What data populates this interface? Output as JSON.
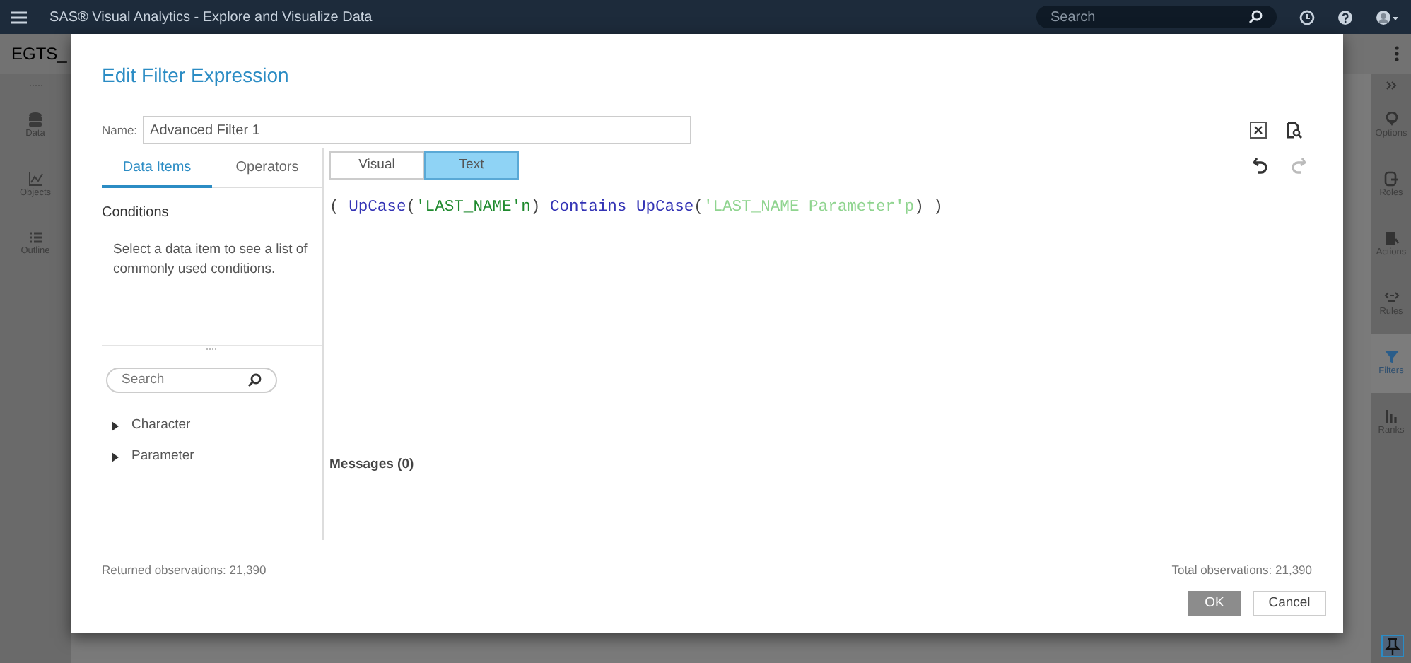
{
  "app": {
    "title": "SAS® Visual Analytics - Explore and Visualize Data",
    "search_placeholder": "Search",
    "report_title": "EGTS_",
    "left_rail": [
      {
        "label": "Data"
      },
      {
        "label": "Objects"
      },
      {
        "label": "Outline"
      }
    ],
    "right_rail": [
      {
        "label": "Options",
        "selected": false
      },
      {
        "label": "Roles",
        "selected": false
      },
      {
        "label": "Actions",
        "selected": false
      },
      {
        "label": "Rules",
        "selected": false
      },
      {
        "label": "Filters",
        "selected": true
      },
      {
        "label": "Ranks",
        "selected": false
      }
    ]
  },
  "dialog": {
    "title": "Edit Filter Expression",
    "name_label": "Name:",
    "name_value": "Advanced Filter 1",
    "history_buttons": [
      {
        "disabled": false
      },
      {
        "disabled": true
      }
    ],
    "tabs": [
      {
        "label": "Data Items",
        "selected": true
      },
      {
        "label": "Operators",
        "selected": false
      }
    ],
    "section": "Conditions",
    "hint": "Select a data item to see a list of commonly used conditions.",
    "search_placeholder": "Search",
    "tree": [
      {
        "label": "Character",
        "expanded": false
      },
      {
        "label": "Parameter",
        "expanded": false
      }
    ],
    "modes": [
      {
        "label": "Visual",
        "selected": false
      },
      {
        "label": "Text",
        "selected": true
      }
    ],
    "expression": [
      {
        "text": "( ",
        "kind": "punct"
      },
      {
        "text": "UpCase",
        "kind": "function"
      },
      {
        "text": "(",
        "kind": "punct"
      },
      {
        "text": "'LAST_NAME'n",
        "kind": "column"
      },
      {
        "text": ")",
        "kind": "punct"
      },
      {
        "text": " Contains ",
        "kind": "operator"
      },
      {
        "text": "UpCase",
        "kind": "function"
      },
      {
        "text": "(",
        "kind": "punct"
      },
      {
        "text": "'LAST_NAME Parameter'p",
        "kind": "parameter"
      },
      {
        "text": ") )",
        "kind": "punct"
      }
    ],
    "messages": "Messages (0)",
    "returned": "Returned observations: 21,390",
    "total": "Total observations: 21,390",
    "buttons": [
      {
        "label": "OK",
        "disabled": true
      },
      {
        "label": "Cancel",
        "disabled": false
      }
    ]
  }
}
